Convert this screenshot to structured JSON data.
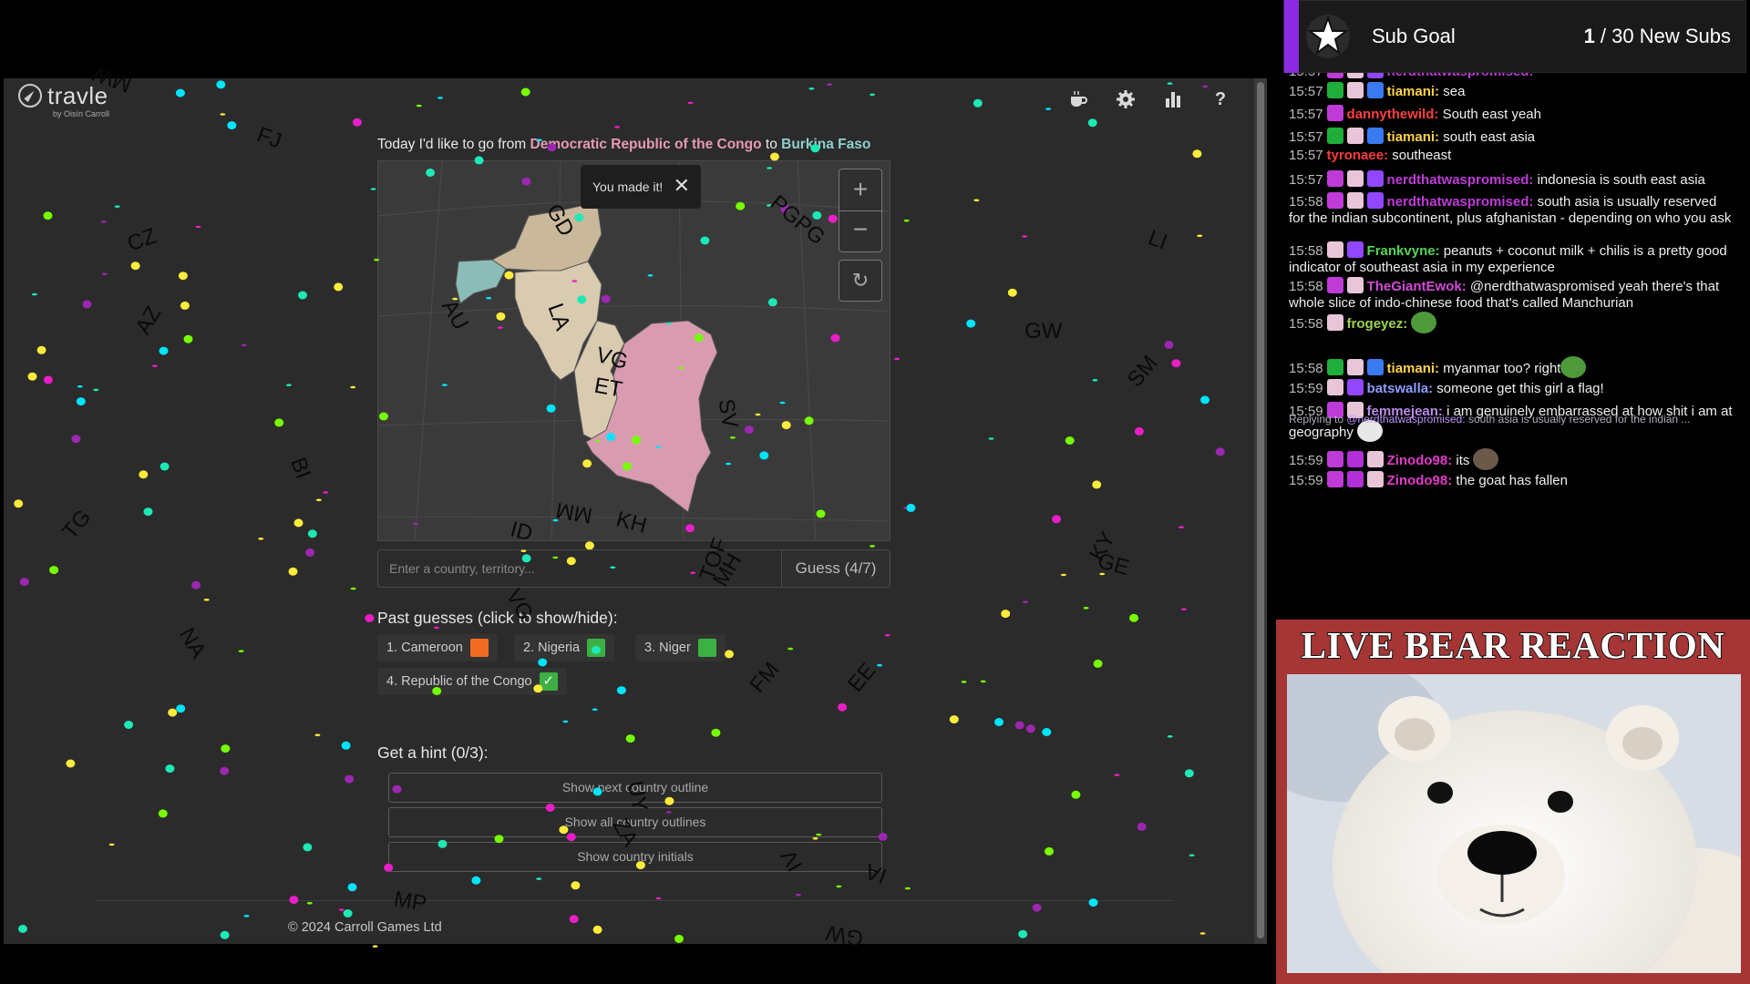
{
  "app": {
    "brand": "travle",
    "byline": "by Oisín Carroll",
    "toolbar_icons": [
      "coffee-icon",
      "gear-icon",
      "bar-chart-icon",
      "help-icon"
    ]
  },
  "prompt": {
    "lead": "Today I'd like to go from ",
    "from": "Democratic Republic of the Congo",
    "mid": " to ",
    "to": "Burkina Faso"
  },
  "map": {
    "toast": "You made it!",
    "zoom_in": "+",
    "zoom_out": "−",
    "reset": "↻",
    "country_colors": {
      "start": "#d99bb0",
      "end": "#8bbcb7",
      "path_a": "#d9cbb0",
      "path_b": "#c9b89a"
    }
  },
  "guess": {
    "placeholder": "Enter a country, territory...",
    "button": "Guess (4/7)"
  },
  "past_guesses": {
    "heading": "Past guesses (click to show/hide):",
    "items": [
      {
        "label": "1.  Cameroon",
        "status": "orange",
        "color": "#f26b21"
      },
      {
        "label": "2.  Nigeria",
        "status": "green",
        "color": "#3cb043"
      },
      {
        "label": "3.  Niger",
        "status": "green",
        "color": "#3cb043"
      },
      {
        "label": "4.  Republic of the Congo",
        "status": "check",
        "color": "#3cb043"
      }
    ]
  },
  "hints": {
    "heading": "Get a hint (0/3):",
    "buttons": [
      "Show next country outline",
      "Show all country outlines",
      "Show country initials"
    ]
  },
  "footer": {
    "copyright": "© 2024 Carroll Games Ltd"
  },
  "overlay_codes": [
    "MW",
    "FJ",
    "CZ",
    "AZ",
    "BI",
    "TG",
    "NA",
    "GD",
    "AU",
    "LA",
    "VG",
    "ET",
    "SV",
    "ID",
    "KH",
    "MM",
    "TOF",
    "MH",
    "PGPG",
    "FM",
    "EE",
    "LI",
    "GW",
    "SM",
    "KY",
    "GE",
    "MP",
    "ZA",
    "GW",
    "IV",
    "UY",
    "IA",
    "VG"
  ],
  "sub_goal": {
    "label": "Sub Goal",
    "current": "1",
    "rest": " / 30 New Subs"
  },
  "chat": [
    {
      "time": "15:57",
      "badges": [
        "heart",
        "gift",
        "diamond"
      ],
      "user": "nerdthatwaspromised:",
      "color": "#bf3bd8",
      "text": ""
    },
    {
      "time": "15:57",
      "badges": [
        "sword",
        "gift",
        "verify"
      ],
      "user": "tiamani:",
      "color": "#ffd34a",
      "text": "sea"
    },
    {
      "time": "15:57",
      "badges": [
        "heart"
      ],
      "user": "dannythewild:",
      "color": "#ff4040",
      "text": "South east yeah"
    },
    {
      "time": "15:57",
      "badges": [
        "sword",
        "gift",
        "verify"
      ],
      "user": "tiamani:",
      "color": "#ffd34a",
      "text": "south east asia"
    },
    {
      "time": "15:57",
      "badges": [],
      "user": "tyronaee:",
      "color": "#ff3a3a",
      "text": "southeast"
    },
    {
      "time": "15:57",
      "badges": [
        "heart",
        "gift",
        "diamond"
      ],
      "user": "nerdthatwaspromised:",
      "color": "#bf3bd8",
      "text": "indonesia is south east asia"
    },
    {
      "time": "15:58",
      "badges": [
        "heart",
        "gift",
        "diamond"
      ],
      "user": "nerdthatwaspromised:",
      "color": "#bf3bd8",
      "text": "south asia is usually reserved for the indian subcontinent, plus afghanistan - depending on who you ask"
    },
    {
      "time": "15:58",
      "badges": [
        "gift",
        "diamond"
      ],
      "user": "Frankvyne:",
      "color": "#56d456",
      "text": "peanuts + coconut milk + chilis is a pretty good indicator of southeast asia in my experience"
    },
    {
      "time": "15:58",
      "badges": [
        "heart",
        "gift"
      ],
      "user": "TheGiantEwok:",
      "color": "#d24bd8",
      "text": "@nerdthatwaspromised yeah there's that whole slice of indo-chinese food that's called Manchurian"
    },
    {
      "time": "15:58",
      "badges": [
        "gift"
      ],
      "user": "frogeyez:",
      "color": "#9bd64b",
      "text": ""
    },
    {
      "time": "15:58",
      "badges": [
        "sword",
        "gift",
        "verify"
      ],
      "user": "tiamani:",
      "color": "#ffd34a",
      "text": "myanmar too? right"
    },
    {
      "time": "15:59",
      "badges": [
        "gift",
        "diamond"
      ],
      "user": "batswalla:",
      "color": "#8f9bff",
      "text": "someone get this girl a flag!"
    },
    {
      "time": "15:59",
      "badges": [
        "heart",
        "gift"
      ],
      "user": "femmejean:",
      "color": "#b98ae8",
      "text": "i am genuinely embarrassed at how shit i am at geography"
    },
    {
      "time": "15:59",
      "badges": [
        "heart",
        "sub1",
        "gift"
      ],
      "user": "Zinodo98:",
      "color": "#e13cc8",
      "text": "its"
    },
    {
      "time": "15:59",
      "badges": [
        "heart",
        "sub1",
        "gift"
      ],
      "user": "Zinodo98:",
      "color": "#e13cc8",
      "text": "the goat has fallen"
    }
  ],
  "chat_reply": {
    "lead": "Replying to ",
    "user": "@nerdthatwaspromised:",
    "text": " south asia is usually reserved for the indian ..."
  },
  "bear": {
    "title": "LIVE BEAR REACTION"
  }
}
